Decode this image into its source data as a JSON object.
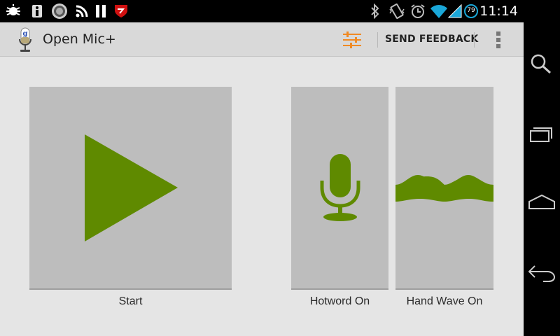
{
  "status_bar": {
    "time": "11:14",
    "battery_level": "79",
    "icons": [
      "bug-icon",
      "info-icon",
      "seal-icon",
      "rss-icon",
      "pause-icon",
      "shield-icon",
      "bluetooth-icon",
      "vibrate-icon",
      "alarm-icon",
      "wifi-icon",
      "signal-icon",
      "battery-icon"
    ]
  },
  "action_bar": {
    "title": "Open Mic+",
    "feedback_label": "SEND FEEDBACK",
    "app_icon": "microphone-logo-icon",
    "settings_icon": "sliders-icon",
    "overflow_icon": "more-vertical-icon"
  },
  "tiles": [
    {
      "label": "Start",
      "icon": "play-icon"
    },
    {
      "label": "Hotword On",
      "icon": "microphone-icon"
    },
    {
      "label": "Hand Wave On",
      "icon": "wave-icon"
    }
  ],
  "colors": {
    "accent": "#5f8a00",
    "slider_accent": "#f08a24",
    "tile": "#bdbdbd",
    "background": "#e5e5e5"
  },
  "nav_bar": {
    "buttons": [
      "search-icon",
      "recent-apps-icon",
      "home-icon",
      "back-icon"
    ]
  }
}
